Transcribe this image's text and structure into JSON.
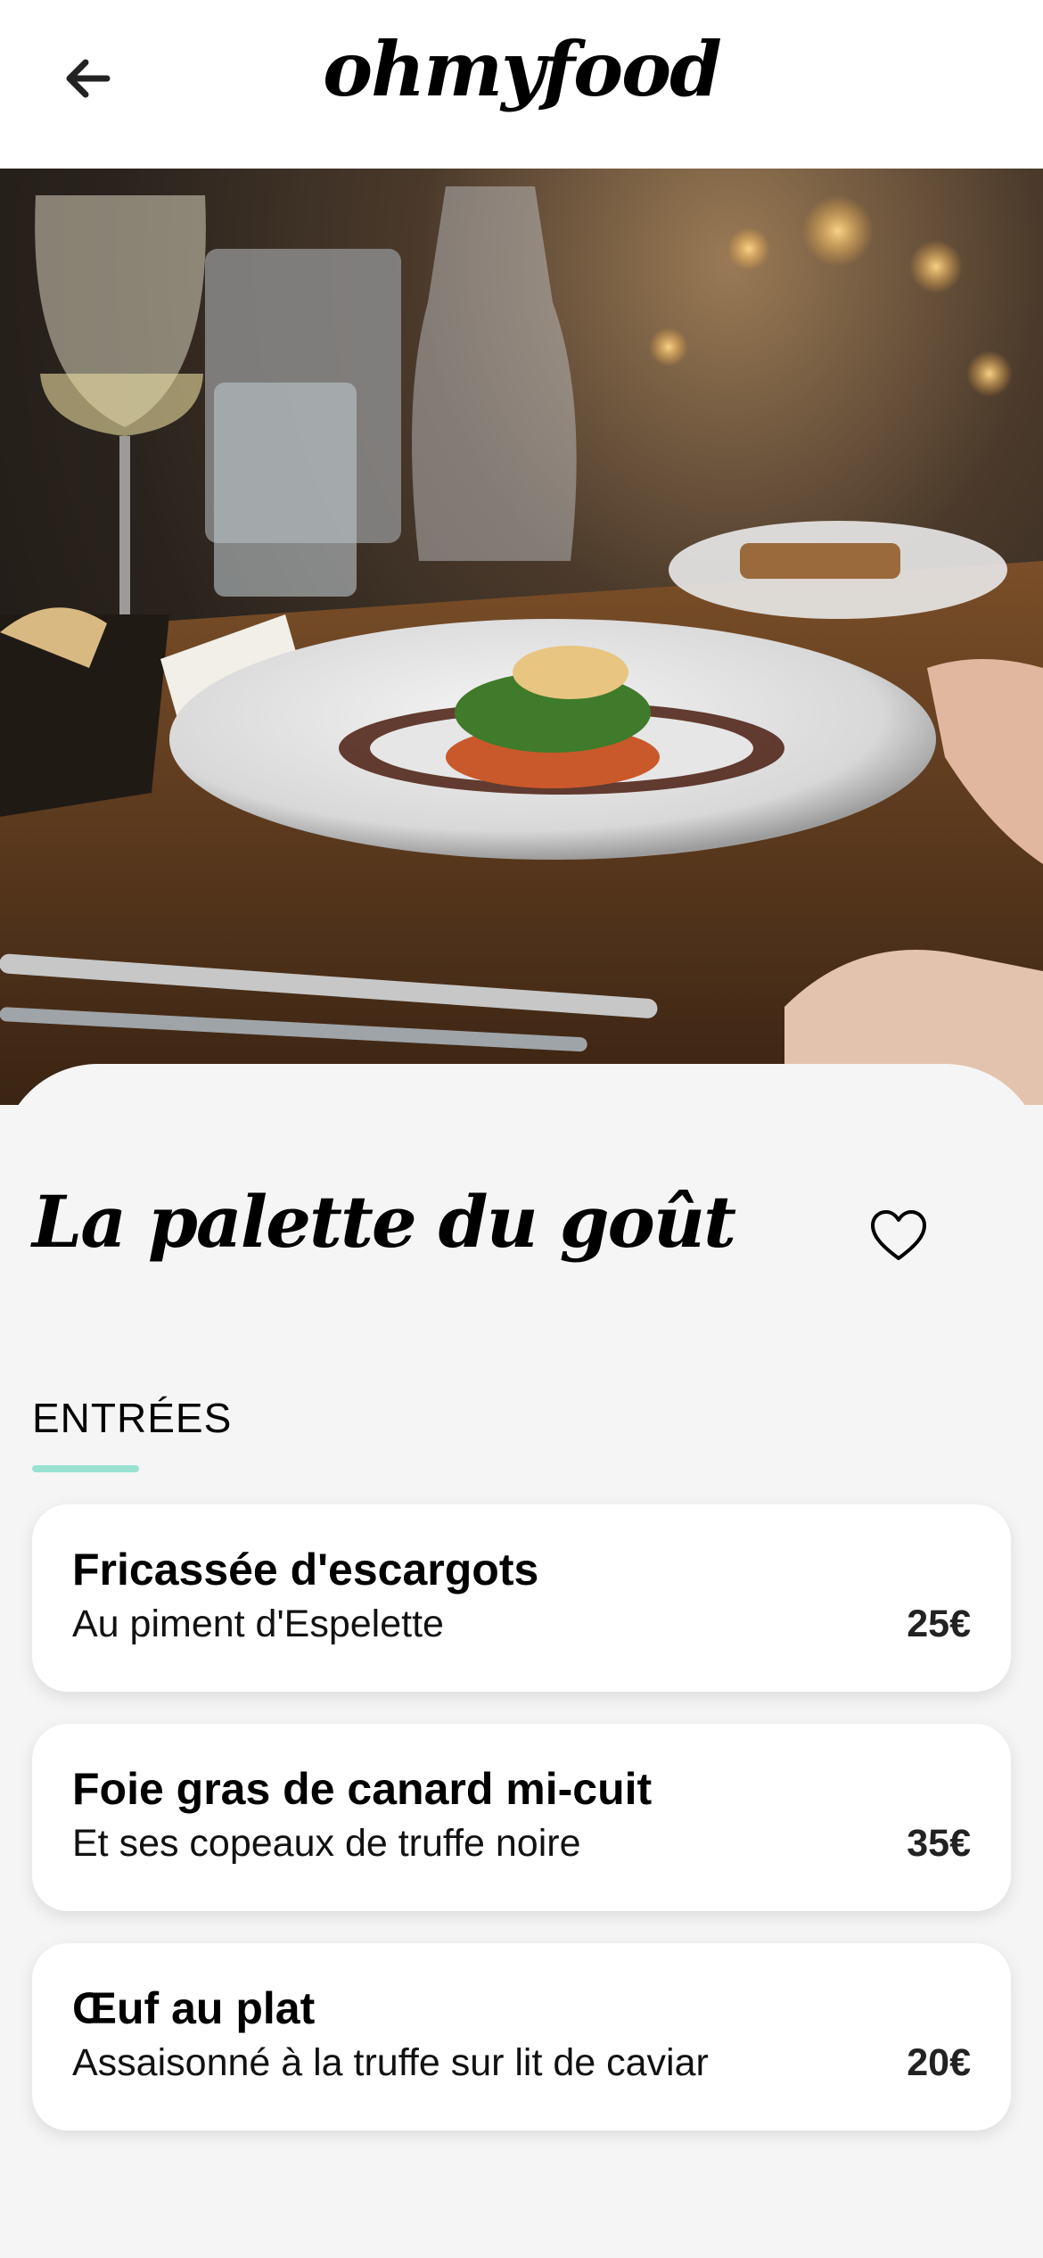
{
  "header": {
    "brand": "ohmyfood",
    "back_icon": "arrow-left-icon"
  },
  "hero": {
    "description": "restaurant-table-dish-photo"
  },
  "restaurant": {
    "name": "La palette du goût",
    "favorite_icon": "heart-outline-icon"
  },
  "menu": {
    "section_title": "ENTRÉES",
    "accent_color": "#99e2d0",
    "items": [
      {
        "name": "Fricassée d'escargots",
        "description": "Au piment d'Espelette",
        "price": "25€"
      },
      {
        "name": "Foie gras de canard mi-cuit",
        "description": "Et ses copeaux de truffe noire",
        "price": "35€"
      },
      {
        "name": "Œuf au plat",
        "description": "Assaisonné à la truffe sur lit de caviar",
        "price": "20€"
      }
    ]
  }
}
